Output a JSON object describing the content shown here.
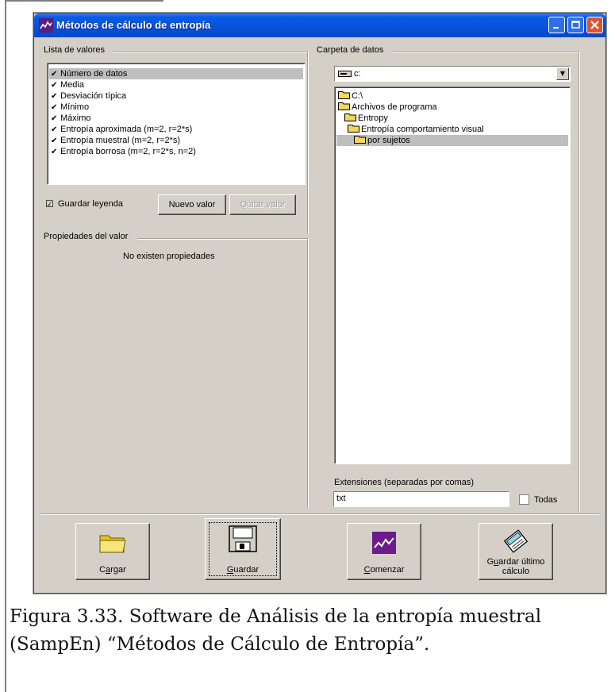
{
  "window": {
    "title": "Métodos de cálculo de entropía"
  },
  "left_panel": {
    "values_group_label": "Lista de valores",
    "values": [
      {
        "label": "Número de datos",
        "checked": true,
        "selected": true
      },
      {
        "label": "Media",
        "checked": true
      },
      {
        "label": "Desviación típica",
        "checked": true
      },
      {
        "label": "Mínimo",
        "checked": true
      },
      {
        "label": "Máximo",
        "checked": true
      },
      {
        "label": "Entropía aproximada (m=2, r=2*s)",
        "checked": true
      },
      {
        "label": "Entropía muestral (m=2, r=2*s)",
        "checked": true
      },
      {
        "label": "Entropía borrosa (m=2, r=2*s, n=2)",
        "checked": true
      }
    ],
    "save_legend_label": "Guardar leyenda",
    "new_value_label": "Nuevo valor",
    "remove_label": "Quitar valor",
    "properties_group_label": "Propiedades del valor",
    "no_properties_text": "No existen propiedades"
  },
  "right_panel": {
    "folder_group_label": "Carpeta de datos",
    "drive_value": "c:",
    "folders": [
      {
        "label": "C:\\",
        "level": 0
      },
      {
        "label": "Archivos de programa",
        "level": 1
      },
      {
        "label": "Entropy",
        "level": 2
      },
      {
        "label": "Entropía comportamiento visual",
        "level": 3
      },
      {
        "label": "por sujetos",
        "level": 4,
        "selected": true
      }
    ],
    "extensions_label": "Extensiones (separadas por comas)",
    "extensions_value": "txt",
    "all_label": "Todas"
  },
  "bottom_buttons": {
    "load": {
      "pre": "C",
      "acc": "a",
      "post": "rgar"
    },
    "save": {
      "pre": "",
      "acc": "G",
      "post": "uardar"
    },
    "start": {
      "pre": "",
      "acc": "C",
      "post": "omenzar"
    },
    "save_last": {
      "line1_pre": "G",
      "line1_acc": "u",
      "line1_post": "ardar último",
      "line2": "cálculo"
    }
  },
  "caption": {
    "line1": "Figura 3.33.  Software de Análisis de la entropía muestral",
    "line2": "(SampEn) “Métodos de Cálculo de Entropía”."
  },
  "colors": {
    "titlebar": "#0551d8",
    "dialog_bg": "#d4d0c8",
    "selection": "#bebebe",
    "folder": "#f3d65a",
    "start_icon": "#6b1b8c"
  }
}
